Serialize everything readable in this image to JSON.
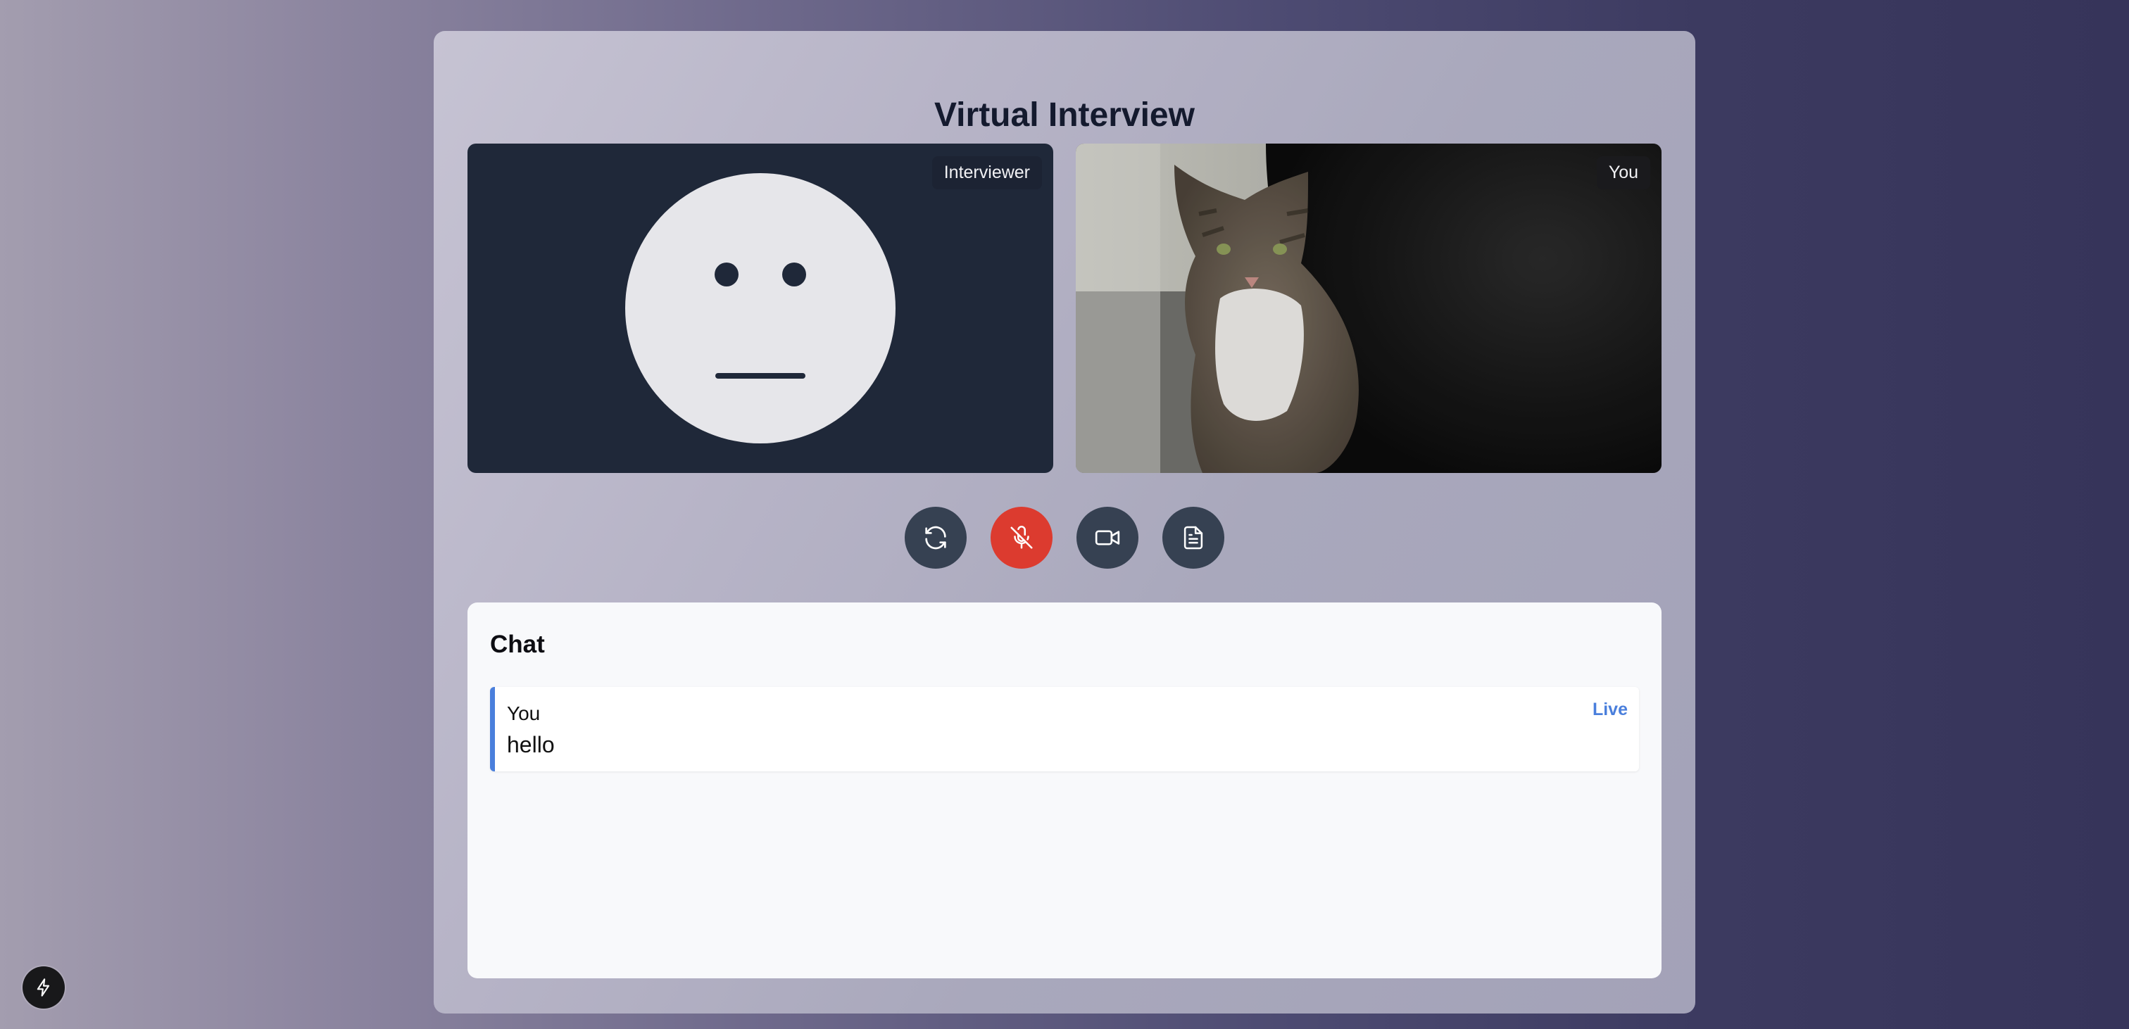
{
  "page": {
    "title": "Virtual Interview"
  },
  "videos": {
    "interviewer_label": "Interviewer",
    "self_label": "You"
  },
  "controls": [
    {
      "icon": "refresh-icon",
      "state": "normal"
    },
    {
      "icon": "mic-off-icon",
      "state": "muted"
    },
    {
      "icon": "video-camera-icon",
      "state": "normal"
    },
    {
      "icon": "document-icon",
      "state": "normal"
    }
  ],
  "chat": {
    "heading": "Chat",
    "messages": [
      {
        "author": "You",
        "text": "hello",
        "status": "Live"
      }
    ]
  },
  "colors": {
    "muted_button": "#dc3b2f",
    "control_button": "#364152",
    "accent": "#4a7fdc",
    "video_bg": "#1f2839"
  }
}
